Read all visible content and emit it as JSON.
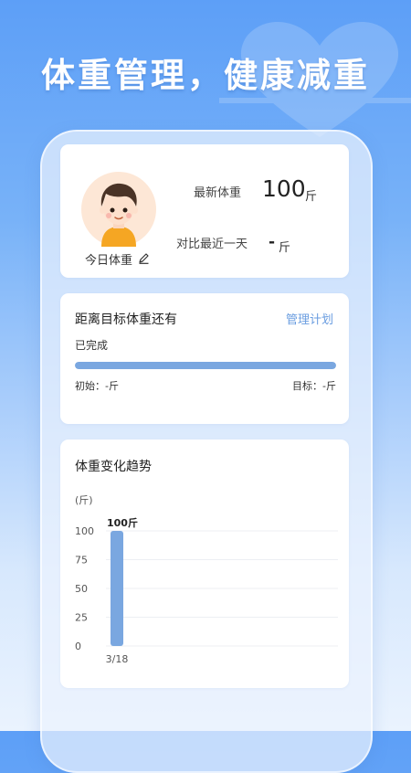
{
  "headline": "体重管理，健康减重",
  "weight_card": {
    "today_label": "今日体重",
    "latest_label": "最新体重",
    "latest_value": "100",
    "latest_unit": "斤",
    "compare_label": "对比最近一天",
    "compare_value": "-",
    "compare_unit": "斤"
  },
  "goal_card": {
    "title": "距离目标体重还有",
    "manage_link": "管理计划",
    "status": "已完成",
    "progress": 1.0,
    "start_label": "初始：-斤",
    "target_label": "目标：-斤"
  },
  "trend_card": {
    "title": "体重变化趋势"
  },
  "colors": {
    "accent": "#6a9de0",
    "bar": "#7aa7e0",
    "progress": "#7aa7e0"
  },
  "chart_data": {
    "type": "bar",
    "categories": [
      "3/18"
    ],
    "values": [
      100
    ],
    "data_labels": [
      "100斤"
    ],
    "ylabel": "(斤)",
    "yticks": [
      100,
      75,
      50,
      25,
      0
    ],
    "ylim": [
      0,
      100
    ],
    "grid": true
  }
}
